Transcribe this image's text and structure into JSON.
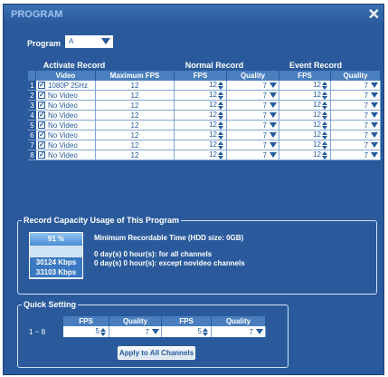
{
  "window": {
    "title": "PROGRAM",
    "close_icon": "close-icon"
  },
  "program": {
    "label": "Program",
    "selected": "A"
  },
  "groups": {
    "activate": "Activate Record",
    "normal": "Normal Record",
    "event": "Event Record"
  },
  "table": {
    "headers": [
      "Video",
      "Maximum FPS",
      "FPS",
      "Quality",
      "FPS",
      "Quality"
    ],
    "rows": [
      {
        "num": "1",
        "video": "1080P 25Hz",
        "max_fps": "12",
        "n_fps": "12",
        "n_quality": "7",
        "e_fps": "12",
        "e_quality": "7"
      },
      {
        "num": "2",
        "video": "No Video",
        "max_fps": "12",
        "n_fps": "12",
        "n_quality": "7",
        "e_fps": "12",
        "e_quality": "7"
      },
      {
        "num": "3",
        "video": "No Video",
        "max_fps": "12",
        "n_fps": "12",
        "n_quality": "7",
        "e_fps": "12",
        "e_quality": "7"
      },
      {
        "num": "4",
        "video": "No Video",
        "max_fps": "12",
        "n_fps": "12",
        "n_quality": "7",
        "e_fps": "12",
        "e_quality": "7"
      },
      {
        "num": "5",
        "video": "No Video",
        "max_fps": "12",
        "n_fps": "12",
        "n_quality": "7",
        "e_fps": "12",
        "e_quality": "7"
      },
      {
        "num": "6",
        "video": "No Video",
        "max_fps": "12",
        "n_fps": "12",
        "n_quality": "7",
        "e_fps": "12",
        "e_quality": "7"
      },
      {
        "num": "7",
        "video": "No Video",
        "max_fps": "12",
        "n_fps": "12",
        "n_quality": "7",
        "e_fps": "12",
        "e_quality": "7"
      },
      {
        "num": "8",
        "video": "No Video",
        "max_fps": "12",
        "n_fps": "12",
        "n_quality": "7",
        "e_fps": "12",
        "e_quality": "7"
      }
    ]
  },
  "capacity": {
    "title": "Record Capacity Usage of This Program",
    "percent": "91 %",
    "bitrate_used": "30124 Kbps",
    "bitrate_max": "33103 Kbps",
    "min_time": "Minimum Recordable Time (HDD size: 0GB)",
    "all_channels": "0 day(s) 0 hour(s):  for all channels",
    "except_novideo": "0 day(s) 0 hour(s):  except novideo channels"
  },
  "quick": {
    "title": "Quick Setting",
    "headers": [
      "FPS",
      "Quality",
      "FPS",
      "Quality"
    ],
    "range": "1 ~ 8",
    "n_fps": "5",
    "n_quality": "7",
    "e_fps": "5",
    "e_quality": "7",
    "apply": "Apply to All Channels"
  },
  "colors": {
    "panel": "#2a5a9c",
    "header": "#4a7fbf",
    "title_text": "#9fc2ee",
    "cell_text": "#245a9c"
  }
}
